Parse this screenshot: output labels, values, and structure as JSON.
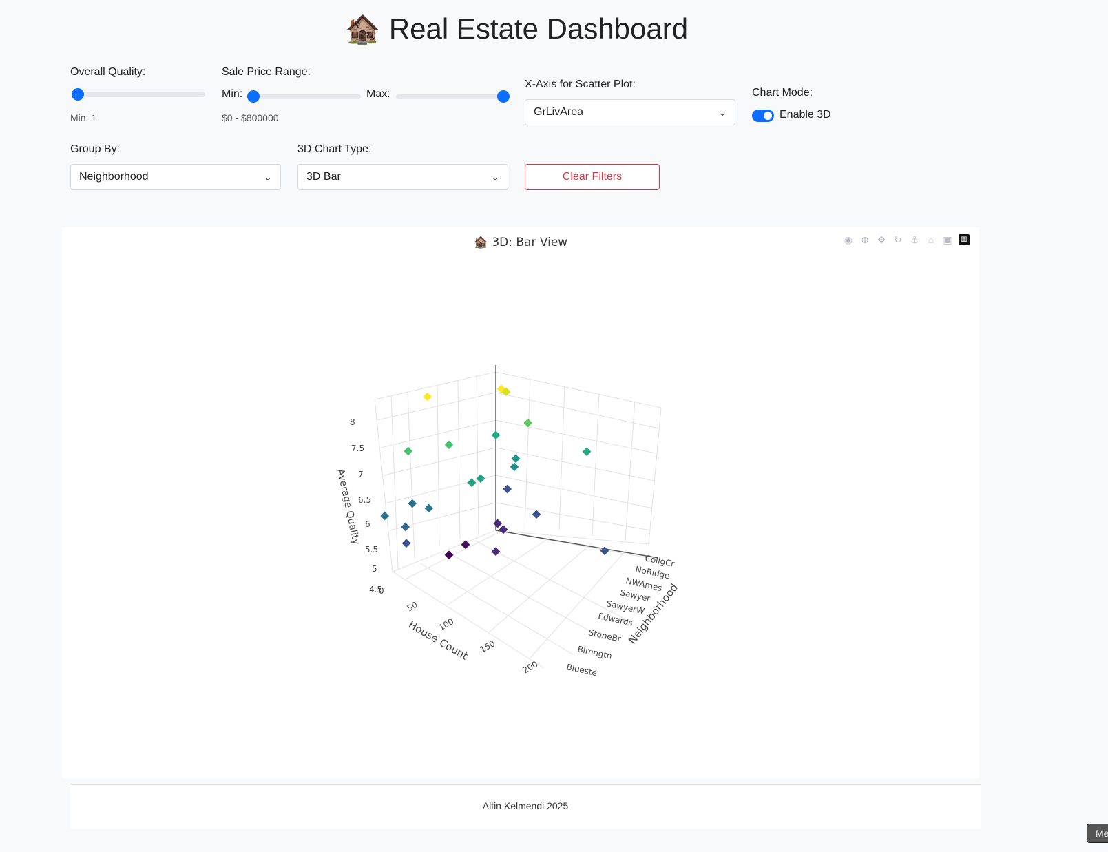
{
  "header": {
    "title": "Real Estate Dashboard",
    "title_icon": "🏚️"
  },
  "filters": {
    "overall_quality": {
      "label": "Overall Quality:",
      "value_text": "Min: 1",
      "min_value": 1
    },
    "sale_price": {
      "label": "Sale Price Range:",
      "min_label": "Min:",
      "max_label": "Max:",
      "range_text": "$0 - $800000"
    },
    "x_axis": {
      "label": "X-Axis for Scatter Plot:",
      "selected": "GrLivArea"
    },
    "chart_mode": {
      "label": "Chart Mode:",
      "toggle_label": "Enable 3D",
      "enabled": true
    },
    "group_by": {
      "label": "Group By:",
      "selected": "Neighborhood"
    },
    "chart_type": {
      "label": "3D Chart Type:",
      "selected": "3D Bar"
    },
    "clear_label": "Clear Filters"
  },
  "chart_title": "🏚️ 3D: Bar View",
  "modebar": [
    "camera-icon",
    "zoom-icon",
    "pan-icon",
    "orbit-icon",
    "turntable-icon",
    "reset-camera-icon",
    "last-save-icon",
    "plotly-logo-icon"
  ],
  "chart_data": {
    "type": "scatter",
    "projection": "3d",
    "x_label": "House Count",
    "x_ticks": [
      "0",
      "50",
      "100",
      "150",
      "200"
    ],
    "y_label": "Neighborhood",
    "y_ticks": [
      "CollgCr",
      "NoRidge",
      "NWAmes",
      "Sawyer",
      "SawyerW",
      "Edwards",
      "StoneBr",
      "Blmngtn",
      "Blueste"
    ],
    "z_label": "Average Quality",
    "z_ticks": [
      "4.5",
      "5",
      "5.5",
      "6",
      "6.5",
      "7",
      "7.5",
      "8"
    ],
    "colorscale": [
      "#440154",
      "#3b528b",
      "#21918c",
      "#5ec962",
      "#fde725"
    ],
    "marker": "diamond"
  },
  "footer": {
    "text": "Altin Kelmendi 2025"
  },
  "corner_button": "Me"
}
